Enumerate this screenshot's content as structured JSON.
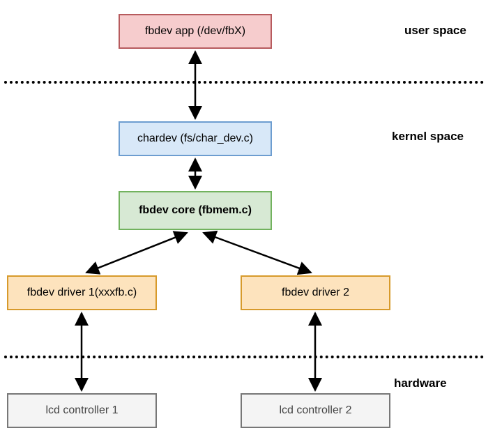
{
  "labels": {
    "userspace": "user space",
    "kernelspace": "kernel space",
    "hardware": "hardware"
  },
  "boxes": {
    "app": "fbdev app (/dev/fbX)",
    "chardev": "chardev (fs/char_dev.c)",
    "core": "fbdev core (fbmem.c)",
    "drv1": "fbdev driver 1(xxxfb.c)",
    "drv2": "fbdev driver 2",
    "lcd1": "lcd controller 1",
    "lcd2": "lcd controller 2"
  }
}
